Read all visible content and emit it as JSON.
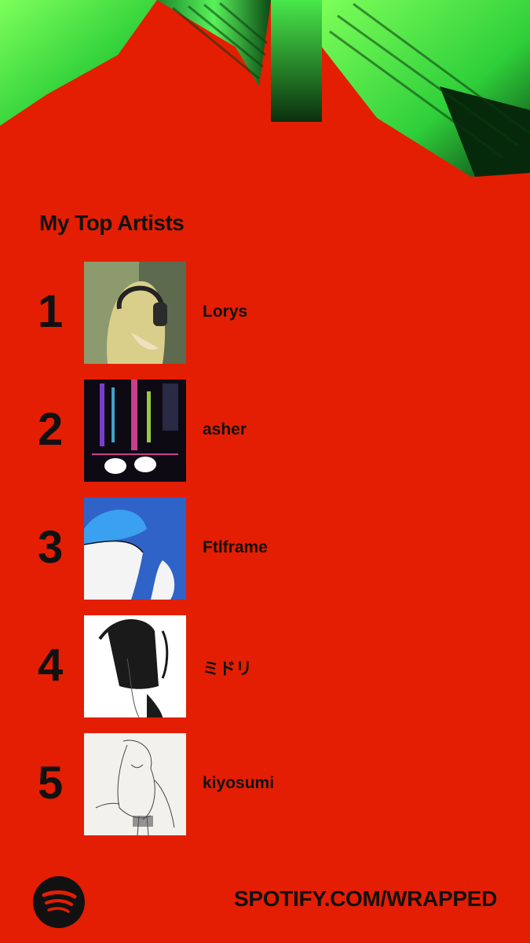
{
  "header": {
    "title": "My Top Artists"
  },
  "artists": [
    {
      "rank": "1",
      "name": "Lorys"
    },
    {
      "rank": "2",
      "name": "asher"
    },
    {
      "rank": "3",
      "name": "Ftlframe"
    },
    {
      "rank": "4",
      "name": "ミドリ"
    },
    {
      "rank": "5",
      "name": "kiyosumi"
    }
  ],
  "footer": {
    "url": "SPOTIFY.COM/WRAPPED",
    "logo_icon": "spotify-logo-icon"
  },
  "colors": {
    "background": "#e41e02",
    "text": "#111111",
    "accent_green": "#1ed760"
  }
}
